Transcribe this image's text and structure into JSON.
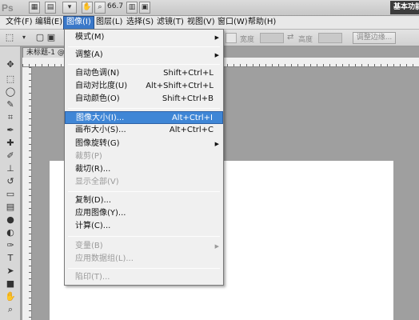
{
  "app": {
    "logo": "Ps",
    "zoom": "66.7",
    "workspace": "基本功能"
  },
  "menubar": {
    "items": [
      "文件(F)",
      "编辑(E)",
      "图像(I)",
      "图层(L)",
      "选择(S)",
      "滤镜(T)",
      "视图(V)",
      "窗口(W)",
      "帮助(H)"
    ]
  },
  "optionsbar": {
    "width_label": "宽度",
    "height_label": "高度",
    "refine_edge": "调整边缘..."
  },
  "document": {
    "tab_title": "未标题-1 @"
  },
  "image_menu": {
    "items": [
      {
        "label": "模式(M)",
        "shortcut": "",
        "submenu": true,
        "disabled": false
      },
      {
        "label": "调整(A)",
        "shortcut": "",
        "submenu": true,
        "disabled": false
      },
      {
        "label": "自动色调(N)",
        "shortcut": "Shift+Ctrl+L",
        "submenu": false,
        "disabled": false
      },
      {
        "label": "自动对比度(U)",
        "shortcut": "Alt+Shift+Ctrl+L",
        "submenu": false,
        "disabled": false
      },
      {
        "label": "自动颜色(O)",
        "shortcut": "Shift+Ctrl+B",
        "submenu": false,
        "disabled": false
      },
      {
        "label": "图像大小(I)...",
        "shortcut": "Alt+Ctrl+I",
        "submenu": false,
        "disabled": false,
        "highlighted": true
      },
      {
        "label": "画布大小(S)...",
        "shortcut": "Alt+Ctrl+C",
        "submenu": false,
        "disabled": false
      },
      {
        "label": "图像旋转(G)",
        "shortcut": "",
        "submenu": true,
        "disabled": false
      },
      {
        "label": "裁剪(P)",
        "shortcut": "",
        "submenu": false,
        "disabled": true
      },
      {
        "label": "裁切(R)...",
        "shortcut": "",
        "submenu": false,
        "disabled": false
      },
      {
        "label": "显示全部(V)",
        "shortcut": "",
        "submenu": false,
        "disabled": true
      },
      {
        "label": "复制(D)...",
        "shortcut": "",
        "submenu": false,
        "disabled": false
      },
      {
        "label": "应用图像(Y)...",
        "shortcut": "",
        "submenu": false,
        "disabled": false
      },
      {
        "label": "计算(C)...",
        "shortcut": "",
        "submenu": false,
        "disabled": false
      },
      {
        "label": "变量(B)",
        "shortcut": "",
        "submenu": true,
        "disabled": true
      },
      {
        "label": "应用数据组(L)...",
        "shortcut": "",
        "submenu": false,
        "disabled": true
      },
      {
        "label": "陷印(T)...",
        "shortcut": "",
        "submenu": false,
        "disabled": true
      }
    ]
  },
  "colors": {
    "highlight": "#3f86d6",
    "menu_bg": "#f0f0f0",
    "workspace_bg": "#9f9f9f"
  }
}
